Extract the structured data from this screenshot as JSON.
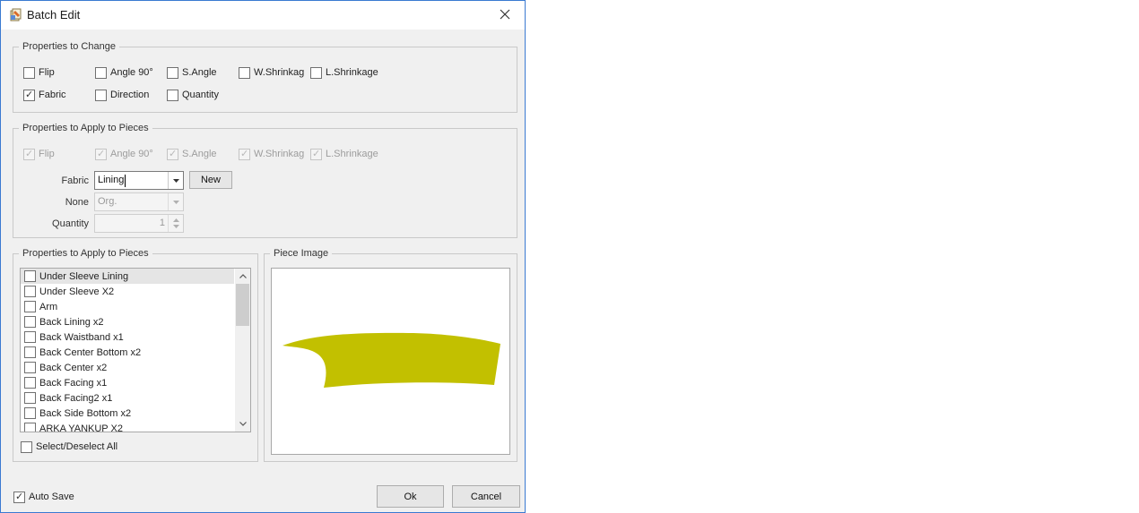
{
  "window": {
    "title": "Batch Edit"
  },
  "change_group": {
    "title": "Properties to Change",
    "options": [
      {
        "label": "Flip",
        "checked": false
      },
      {
        "label": "Angle 90°",
        "checked": false
      },
      {
        "label": "S.Angle",
        "checked": false
      },
      {
        "label": "W.Shrinkag",
        "checked": false
      },
      {
        "label": "L.Shrinkage",
        "checked": false
      },
      {
        "label": "Fabric",
        "checked": true
      },
      {
        "label": "Direction",
        "checked": false
      },
      {
        "label": "Quantity",
        "checked": false
      }
    ]
  },
  "apply_group": {
    "title": "Properties to Apply to Pieces",
    "options": [
      {
        "label": "Flip",
        "checked": true
      },
      {
        "label": "Angle 90°",
        "checked": true
      },
      {
        "label": "S.Angle",
        "checked": true
      },
      {
        "label": "W.Shrinkag",
        "checked": true
      },
      {
        "label": "L.Shrinkage",
        "checked": true
      }
    ],
    "fabric_label": "Fabric",
    "fabric_value": "Lining",
    "new_button": "New",
    "none_label": "None",
    "none_value": "Org.",
    "quantity_label": "Quantity",
    "quantity_value": "1"
  },
  "pieces_group": {
    "title": "Properties to Apply to Pieces",
    "items": [
      {
        "label": "Under Sleeve Lining",
        "checked": false,
        "selected": true
      },
      {
        "label": "Under Sleeve X2",
        "checked": false
      },
      {
        "label": "Arm",
        "checked": false
      },
      {
        "label": "Back Lining x2",
        "checked": false
      },
      {
        "label": "Back Waistband x1",
        "checked": false
      },
      {
        "label": "Back Center Bottom x2",
        "checked": false
      },
      {
        "label": "Back Center x2",
        "checked": false
      },
      {
        "label": "Back Facing x1",
        "checked": false
      },
      {
        "label": "Back Facing2 x1",
        "checked": false
      },
      {
        "label": "Back Side Bottom x2",
        "checked": false
      },
      {
        "label": "ARKA YANKUP X2",
        "checked": false
      }
    ],
    "select_all": "Select/Deselect All"
  },
  "image_group": {
    "title": "Piece Image",
    "piece_color": "#c2c000"
  },
  "footer": {
    "auto_save": "Auto Save",
    "auto_save_checked": true,
    "ok": "Ok",
    "cancel": "Cancel"
  },
  "icons": {
    "app": "batch-edit-icon",
    "close": "close-icon",
    "check": "✓",
    "dropdown": "chevron-down-icon"
  }
}
